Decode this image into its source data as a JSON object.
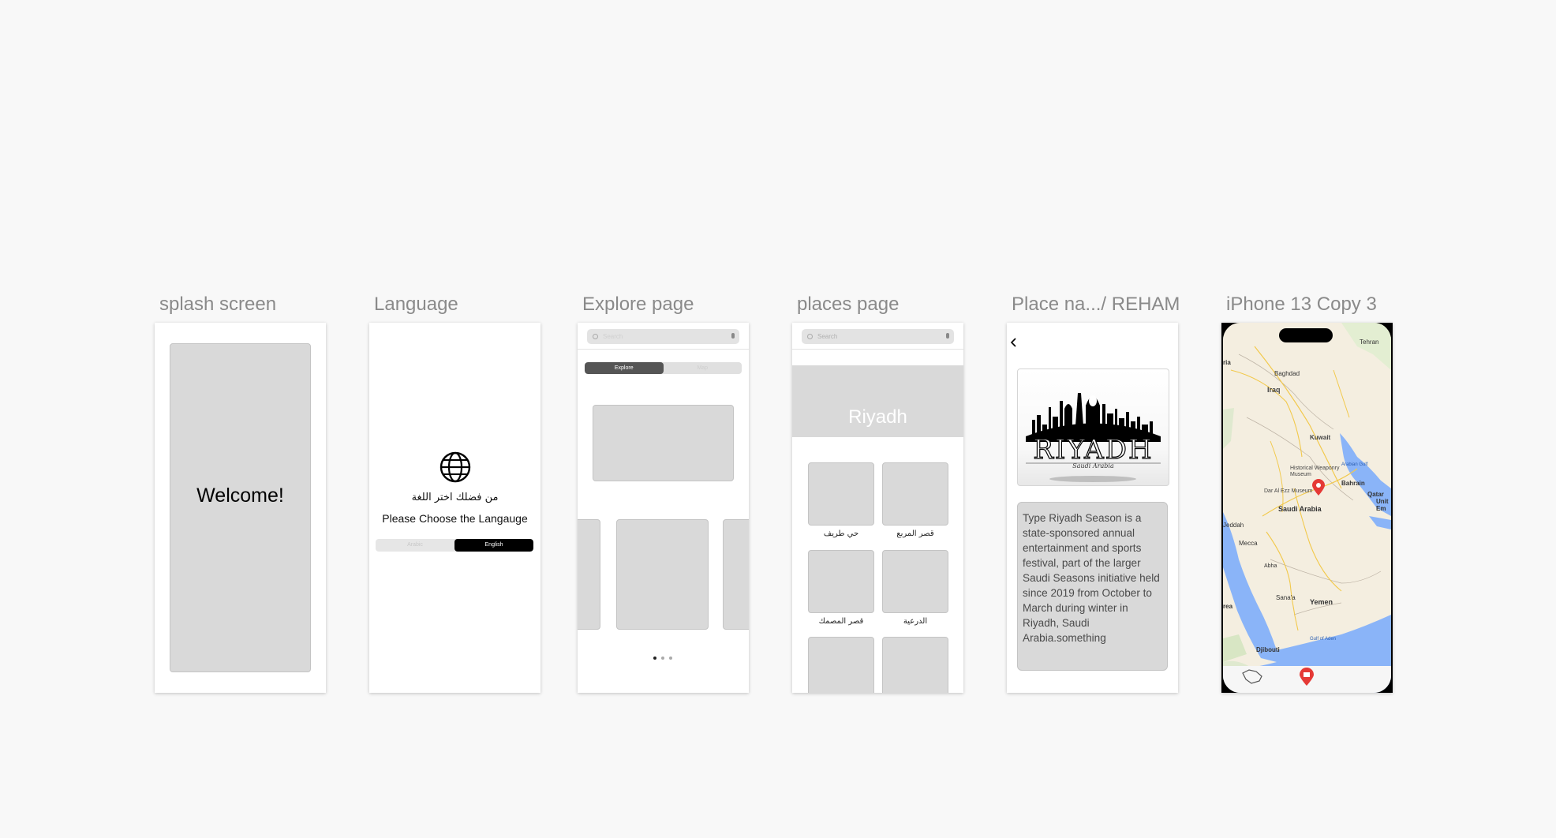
{
  "frames": {
    "splash": {
      "title": "splash screen",
      "welcome": "Welcome!"
    },
    "language": {
      "title": "Language",
      "prompt_ar": "من فضلك اختر اللغة",
      "prompt_en": "Please Choose the Langauge",
      "options": [
        "Arabic",
        "English"
      ],
      "selected": "English"
    },
    "explore": {
      "title": "Explore page",
      "search_placeholder": "Search",
      "tabs": [
        "Explore",
        "Map"
      ],
      "selected_tab": "Explore",
      "page_count": 3,
      "current_page": 1
    },
    "places": {
      "title": "places page",
      "search_placeholder": "Search",
      "hero": "Riyadh",
      "places": [
        "حي طريف",
        "قصر المربع",
        "قصر المصمك",
        "الدرعية"
      ]
    },
    "place_detail": {
      "title": "Place na.../ REHAM",
      "logo_text": "RIYADH",
      "logo_subtext": "Saudi Arabia",
      "description": "Type Riyadh Season is a state-sponsored annual entertainment and sports festival, part of the larger Saudi Seasons initiative held since 2019 from October to March during winter in Riyadh, Saudi Arabia.something"
    },
    "map": {
      "title": "iPhone 13 Copy 3",
      "labels": [
        "Tehran",
        "Baghdad",
        "Iraq",
        "Kuwait",
        "Historical Weaponry Museum",
        "Bahrain",
        "Dar Al Ezz Museum",
        "Qatar",
        "Saudi Arabia",
        "Jeddah",
        "Mecca",
        "Yemen",
        "Sana'a",
        "Djibouti",
        "Gulf of Aden",
        "Abha",
        "Arabian Gulf",
        "rea",
        "ria",
        "Unit Em"
      ]
    },
    "colors": {
      "background": "#f8f8f8",
      "placeholder": "#d9d9d9",
      "accent": "#000000",
      "pin": "#e53935",
      "water": "#8ab4f8",
      "land": "#f5efe0"
    }
  }
}
